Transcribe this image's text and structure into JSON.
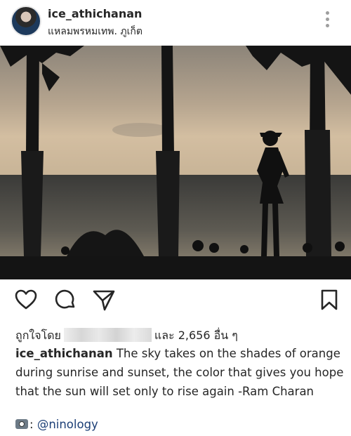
{
  "post": {
    "username": "ice_athichanan",
    "location": "แหลมพรหมเทพ. ภูเก็ต",
    "photo_alt": "",
    "likes_prefix": "ถูกใจโดย",
    "likes_suffix": "และ 2,656 อื่น ๆ",
    "caption_user": "ice_athichanan",
    "caption_text": " The sky takes on the shades of orange during sunrise and sunset, the color that gives you hope that the sun will set only to rise again -Ram Charan",
    "credit_prefix": ":",
    "credit_mention": "@ninology"
  },
  "icons": {
    "more": "more-vertical-icon",
    "like": "heart-icon",
    "comment": "comment-icon",
    "share": "send-icon",
    "save": "bookmark-icon",
    "camera": "camera-icon"
  },
  "colors": {
    "text": "#262626",
    "mention": "#1c3f76",
    "icon": "#262626",
    "muted": "#9e9e9e"
  }
}
